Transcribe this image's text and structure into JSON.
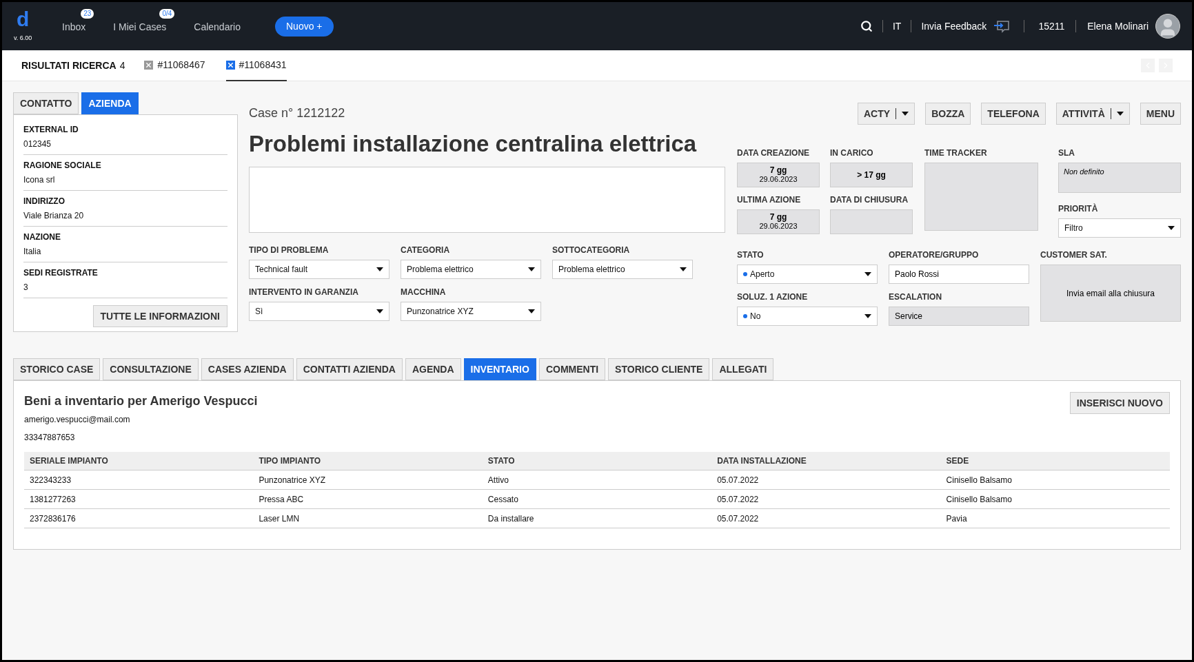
{
  "app": {
    "logo": "d",
    "version": "v. 6.00"
  },
  "nav": [
    {
      "label": "Inbox",
      "badge": "23"
    },
    {
      "label": "I Miei Cases",
      "badge": "0/4"
    },
    {
      "label": "Calendario"
    }
  ],
  "new_button": "Nuovo +",
  "header_right": {
    "language": "IT",
    "feedback": "Invia Feedback",
    "number": "15211",
    "user": "Elena Molinari"
  },
  "search_results": {
    "label": "RISULTATI RICERCA",
    "count": "4"
  },
  "open_tabs": [
    {
      "label": "#11068467",
      "selected": false
    },
    {
      "label": "#11068431",
      "selected": true
    }
  ],
  "left_tabs": [
    {
      "label": "CONTATTO",
      "selected": false
    },
    {
      "label": "AZIENDA",
      "selected": true
    }
  ],
  "company_fields": [
    {
      "label": "EXTERNAL ID",
      "value": "012345"
    },
    {
      "label": "RAGIONE SOCIALE",
      "value": "Icona srl"
    },
    {
      "label": "INDIRIZZO",
      "value": "Viale Brianza 20"
    },
    {
      "label": "NAZIONE",
      "value": "Italia"
    },
    {
      "label": "SEDI REGISTRATE",
      "value": "3"
    }
  ],
  "all_info_button": "TUTTE LE INFORMAZIONI",
  "case": {
    "number": "Case n° 1212122",
    "title": "Problemi installazione centralina elettrica"
  },
  "case_fields": [
    {
      "label": "TIPO DI PROBLEMA",
      "value": "Technical fault"
    },
    {
      "label": "CATEGORIA",
      "value": "Problema elettrico"
    },
    {
      "label": "SOTTOCATEGORIA",
      "value": "Problema elettrico"
    },
    {
      "label": "INTERVENTO IN GARANZIA",
      "value": "Sì"
    },
    {
      "label": "MACCHINA",
      "value": "Punzonatrice XYZ"
    }
  ],
  "actions": [
    {
      "label": "ACTY",
      "kind": "split"
    },
    {
      "label": "BOZZA",
      "kind": "plain"
    },
    {
      "label": "TELEFONA",
      "kind": "plain"
    },
    {
      "label": "ATTIVITÀ",
      "kind": "split"
    },
    {
      "label": "MENU",
      "kind": "plain"
    }
  ],
  "dates": {
    "creation": {
      "label": "DATA CREAZIONE",
      "value": "7 gg",
      "date": "29.06.2023"
    },
    "in_charge": {
      "label": "IN CARICO",
      "value": "> 17 gg"
    },
    "last_action": {
      "label": "ULTIMA AZIONE",
      "value": "7 gg",
      "date": "29.06.2023"
    },
    "closing": {
      "label": "DATA DI CHIUSURA"
    },
    "time_tracker": {
      "label": "TIME TRACKER"
    },
    "sla": {
      "label": "SLA",
      "value": "Non definito"
    },
    "priority": {
      "label": "PRIORITÀ",
      "value": "Filtro"
    }
  },
  "status_fields": [
    {
      "label": "STATO",
      "value": "Aperto",
      "kind": "dot-select",
      "color": "#1a6ee8"
    },
    {
      "label": "OPERATORE/GRUPPO",
      "value": "Paolo Rossi",
      "kind": "input"
    },
    {
      "label": "SOLUZ. 1 AZIONE",
      "value": "No",
      "kind": "dot-select",
      "color": "#1a6ee8"
    },
    {
      "label": "ESCALATION",
      "value": "Service",
      "kind": "readonly"
    }
  ],
  "customer_sat": {
    "label": "CUSTOMER SAT.",
    "text": "Invia email alla chiusura"
  },
  "bottom_tabs": [
    {
      "label": "STORICO CASE",
      "selected": false
    },
    {
      "label": "CONSULTAZIONE",
      "selected": false
    },
    {
      "label": "CASES AZIENDA",
      "selected": false
    },
    {
      "label": "CONTATTI AZIENDA",
      "selected": false
    },
    {
      "label": "AGENDA",
      "selected": false
    },
    {
      "label": "INVENTARIO",
      "selected": true
    },
    {
      "label": "COMMENTI",
      "selected": false
    },
    {
      "label": "STORICO CLIENTE",
      "selected": false
    },
    {
      "label": "ALLEGATI",
      "selected": false
    }
  ],
  "inventory": {
    "title": "Beni a inventario per Amerigo Vespucci",
    "email": "amerigo.vespucci@mail.com",
    "phone": "33347887653",
    "button": "INSERISCI NUOVO",
    "columns": [
      "SERIALE IMPIANTO",
      "TIPO IMPIANTO",
      "STATO",
      "DATA INSTALLAZIONE",
      "SEDE"
    ],
    "rows": [
      [
        "322343233",
        "Punzonatrice XYZ",
        "Attivo",
        "05.07.2022",
        "Cinisello Balsamo"
      ],
      [
        "1381277263",
        "Pressa ABC",
        "Cessato",
        "05.07.2022",
        "Cinisello Balsamo"
      ],
      [
        "2372836176",
        "Laser LMN",
        "Da installare",
        "05.07.2022",
        "Pavia"
      ]
    ]
  }
}
